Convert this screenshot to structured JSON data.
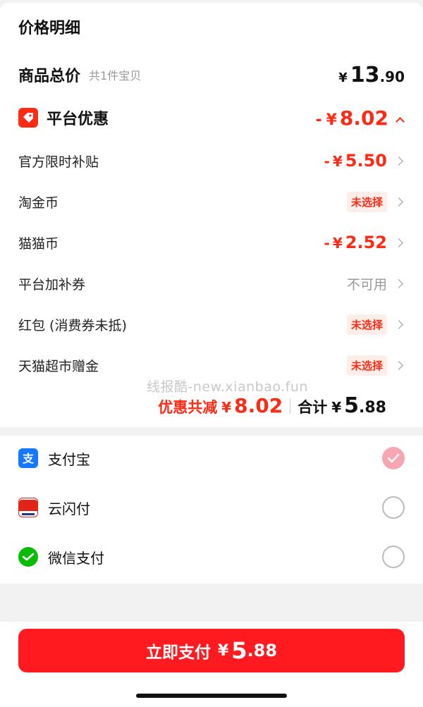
{
  "section_title": "价格明细",
  "goods_total": {
    "label": "商品总价",
    "sub": "共1件宝贝",
    "currency": "¥",
    "int": "13",
    "dec": ".90"
  },
  "platform_discount": {
    "label": "平台优惠",
    "minus": "-",
    "currency": "¥",
    "amount": "8.02"
  },
  "discount_items": [
    {
      "label": "官方限时补贴",
      "type": "amount",
      "minus": "-",
      "currency": "¥",
      "amount": "5.50"
    },
    {
      "label": "淘金币",
      "type": "badge",
      "badge": "未选择"
    },
    {
      "label": "猫猫币",
      "type": "amount",
      "minus": "-",
      "currency": "¥",
      "amount": "2.52"
    },
    {
      "label": "平台加补券",
      "type": "text",
      "text": "不可用"
    },
    {
      "label": "红包 (消费券未抵)",
      "type": "badge",
      "badge": "未选择"
    },
    {
      "label": "天猫超市赠金",
      "type": "badge",
      "badge": "未选择"
    }
  ],
  "watermark": "线报酷-new.xianbao.fun",
  "summary": {
    "discount_label": "优惠共减",
    "discount_currency": "¥",
    "discount_amount": "8.02",
    "total_label": "合计",
    "total_currency": "¥",
    "total_int": "5",
    "total_dec": ".88"
  },
  "payment_methods": [
    {
      "label": "支付宝",
      "icon": "alipay-icon",
      "selected": true
    },
    {
      "label": "云闪付",
      "icon": "unionpay-icon",
      "selected": false
    },
    {
      "label": "微信支付",
      "icon": "wechat-pay-icon",
      "selected": false
    }
  ],
  "pay_button": {
    "label": "立即支付",
    "currency": "¥",
    "int": "5",
    "dec": ".88"
  },
  "colors": {
    "accent": "#ff2a14",
    "button": "#ff1a1f",
    "alipay": "#1677ff",
    "wechat": "#09bb07",
    "selected_radio": "#f6a7b1"
  }
}
